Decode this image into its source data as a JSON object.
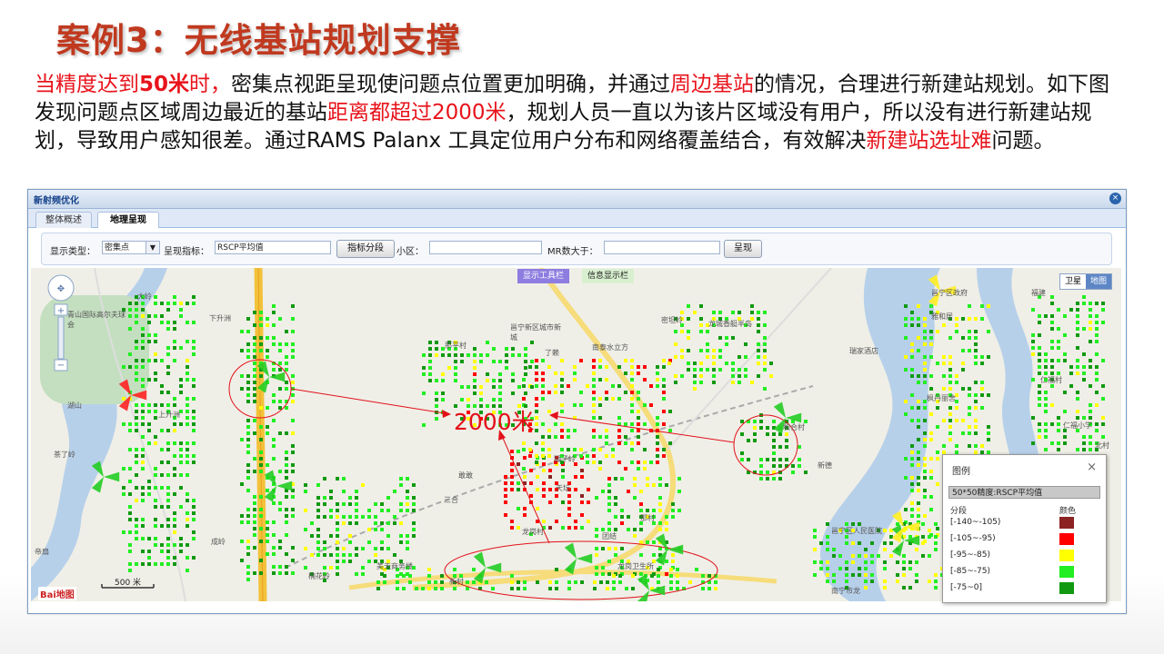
{
  "slide": {
    "title": "案例3：无线基站规划支撑",
    "para": {
      "p1": "当精度达到",
      "p2": "50米",
      "p3": "时，",
      "p4": "密集点视距呈现使问题点位置更加明确，并通过",
      "p5": "周边基站",
      "p6": "的情况，合理进行新建站规划。如下图发现问题点区域周边最近的基站",
      "p7": "距离都超过2000米",
      "p8": "，规划人员一直以为该片区域没有用户，所以没有进行新建站规划，导致用户感知很差。通过RAMS Palanx 工具定位用户分布和网络覆盖结合，有效解决",
      "p9": "新建站选址难",
      "p10": "问题。"
    }
  },
  "window": {
    "title": "新射频优化",
    "close_icon": "×",
    "tabs": [
      {
        "label": "整体概述"
      },
      {
        "label": "地理呈现"
      }
    ],
    "toolbar": {
      "display_type_label": "显示类型：",
      "display_type_value": "密集点",
      "indicator_label": "呈现指标：",
      "indicator_value": "RSCP平均值",
      "segment_button": "指标分段",
      "cell_label": "小区：",
      "cell_value": "",
      "mr_label": "MR数大于：",
      "mr_value": "",
      "render_button": "呈现"
    }
  },
  "map": {
    "toolbar_tab": "显示工具栏",
    "info_tab": "信息显示栏",
    "satellite": "卫星",
    "mapmode": "地图",
    "scale": "500 米",
    "baidu": "Bai地图",
    "annotation": "2000米",
    "places": [
      "大岭",
      "下升洲",
      "青山国际高尔夫球会",
      "上升洲",
      "湖山",
      "茶了岭",
      "帝扇",
      "成岭",
      "楠花岭",
      "邕宁新区城市新城",
      "那平村",
      "了赖",
      "南泰水立方",
      "密坦岭",
      "龙城香艇半岛",
      "敢敢",
      "三合",
      "狮子岭",
      "天坛",
      "龙岗村",
      "团结",
      "新村",
      "美天商务楼",
      "龙岗卫生所",
      "那村",
      "邕宁区政府",
      "雅和居",
      "瑞家酒店",
      "福建",
      "仁福村",
      "枫丹丽舍",
      "仁福小学",
      "和合村",
      "新德",
      "北村",
      "邕宁区人民医院",
      "南宁市龙"
    ]
  },
  "legend": {
    "title": "图例",
    "close": "×",
    "band": "50*50精度:RSCP平均值",
    "col_segment": "分段",
    "col_color": "颜色",
    "rows": [
      {
        "range": "[-140~-105)",
        "color": "#8b2323"
      },
      {
        "range": "[-105~-95)",
        "color": "#ff0000"
      },
      {
        "range": "[-95~-85)",
        "color": "#ffff00"
      },
      {
        "range": "[-85~-75)",
        "color": "#22ee22"
      },
      {
        "range": "[-75~0]",
        "color": "#119911"
      }
    ]
  },
  "icons": {
    "close": "close-icon",
    "pan": "pan-control-icon",
    "zoom_in": "zoom-in-icon",
    "zoom_out": "zoom-out-icon",
    "dropdown": "chevron-down-icon"
  }
}
